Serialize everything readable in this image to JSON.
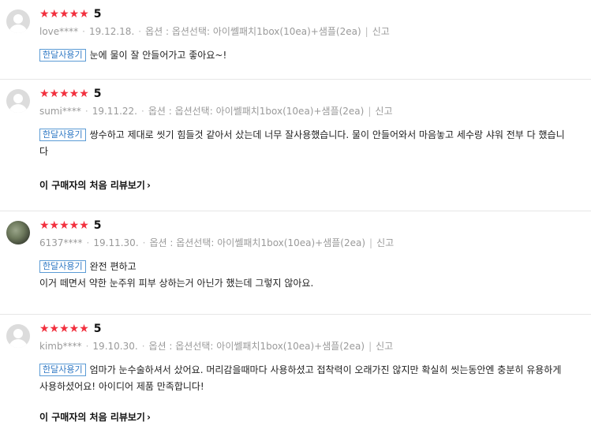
{
  "reviews": [
    {
      "stars": "★★★★★",
      "score": "5",
      "user": "love****",
      "date": "19.12.18.",
      "option": "옵션 : 옵션선택: 아이쎌패치1box(10ea)+샘플(2ea)",
      "report": "신고",
      "badge": "한달사용기",
      "text": "눈에 물이 잘 안들어가고 좋아요~!",
      "text2": "",
      "more": ""
    },
    {
      "stars": "★★★★★",
      "score": "5",
      "user": "sumi****",
      "date": "19.11.22.",
      "option": "옵션 : 옵션선택: 아이쎌패치1box(10ea)+샘플(2ea)",
      "report": "신고",
      "badge": "한달사용기",
      "text": "쌍수하고 제대로 씻기 힘들것 같아서 샀는데 너무 잘사용했습니다. 물이 안들어와서 마음놓고 세수랑 샤워 전부 다 했습니다",
      "text2": "",
      "more": "이 구매자의 처음 리뷰보기"
    },
    {
      "stars": "★★★★★",
      "score": "5",
      "user": "6137****",
      "date": "19.11.30.",
      "option": "옵션 : 옵션선택: 아이쎌패치1box(10ea)+샘플(2ea)",
      "report": "신고",
      "badge": "한달사용기",
      "text": "완전 편하고",
      "text2": "이거 떼면서 약한 눈주위 피부 상하는거 아닌가 했는데 그렇지 않아요.",
      "more": ""
    },
    {
      "stars": "★★★★★",
      "score": "5",
      "user": "kimb****",
      "date": "19.10.30.",
      "option": "옵션 : 옵션선택: 아이쎌패치1box(10ea)+샘플(2ea)",
      "report": "신고",
      "badge": "한달사용기",
      "text": "엄마가 눈수술하셔서 샀어요. 머리감을때마다 사용하셨고 접착력이 오래가진 않지만 확실히 씻는동안엔 충분히 유용하게 사용하셨어요! 아이디어 제품 만족합니다!",
      "text2": "",
      "more": "이 구매자의 처음 리뷰보기"
    }
  ]
}
